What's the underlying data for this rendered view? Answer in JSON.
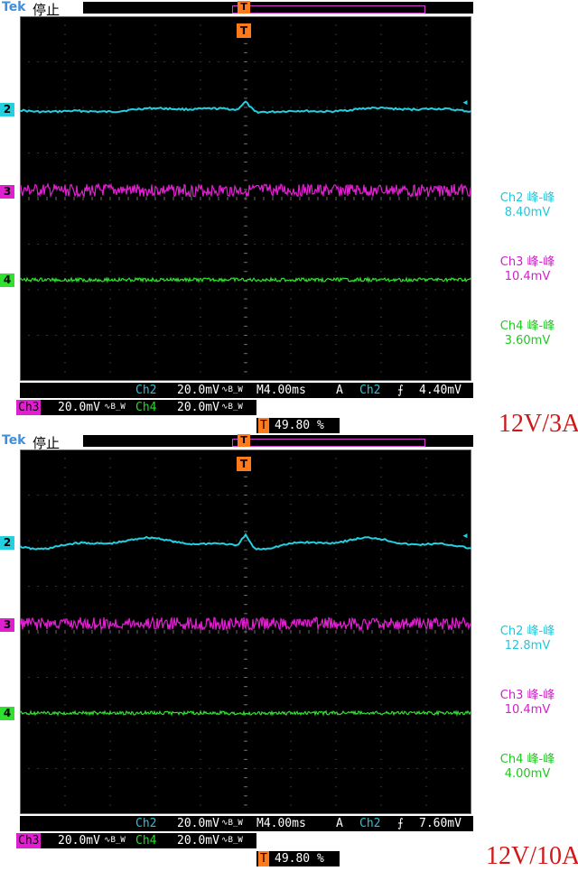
{
  "panels": [
    {
      "header": {
        "brand": "Tek",
        "state": "停止"
      },
      "trigger_marker": "T",
      "channel_markers": {
        "ch2": "2",
        "ch3": "3",
        "ch4": "4"
      },
      "measurements": [
        {
          "label": "Ch2 峰-峰",
          "value": "8.40mV"
        },
        {
          "label": "Ch3 峰-峰",
          "value": "10.4mV"
        },
        {
          "label": "Ch4 峰-峰",
          "value": "3.60mV"
        }
      ],
      "info_line1": {
        "ch": "Ch2",
        "scale": "20.0mV",
        "bw": "∿B_W",
        "timebase": "M4.00ms",
        "trig_mode": "A",
        "trig_ch": "Ch2",
        "slope": "⨍",
        "level": "4.40mV"
      },
      "info_line2": {
        "ch3": "Ch3",
        "scale3": "20.0mV",
        "bw3": "∿B_W",
        "ch4": "Ch4",
        "scale4": "20.0mV",
        "bw4": "∿B_W"
      },
      "info_line3": {
        "marker": "T",
        "pos": "49.80 %"
      },
      "condition": "12V/3A"
    },
    {
      "header": {
        "brand": "Tek",
        "state": "停止"
      },
      "trigger_marker": "T",
      "channel_markers": {
        "ch2": "2",
        "ch3": "3",
        "ch4": "4"
      },
      "measurements": [
        {
          "label": "Ch2 峰-峰",
          "value": "12.8mV"
        },
        {
          "label": "Ch3 峰-峰",
          "value": "10.4mV"
        },
        {
          "label": "Ch4 峰-峰",
          "value": "4.00mV"
        }
      ],
      "info_line1": {
        "ch": "Ch2",
        "scale": "20.0mV",
        "bw": "∿B_W",
        "timebase": "M4.00ms",
        "trig_mode": "A",
        "trig_ch": "Ch2",
        "slope": "⨍",
        "level": "7.60mV"
      },
      "info_line2": {
        "ch3": "Ch3",
        "scale3": "20.0mV",
        "bw3": "∿B_W",
        "ch4": "Ch4",
        "scale4": "20.0mV",
        "bw4": "∿B_W"
      },
      "info_line3": {
        "marker": "T",
        "pos": "49.80 %"
      },
      "condition": "12V/10A"
    }
  ],
  "colors": {
    "ch2": "#22d0e0",
    "ch3": "#e020d0",
    "ch4": "#30e030",
    "trigger": "#ff7a1a",
    "condition": "#d01818"
  }
}
